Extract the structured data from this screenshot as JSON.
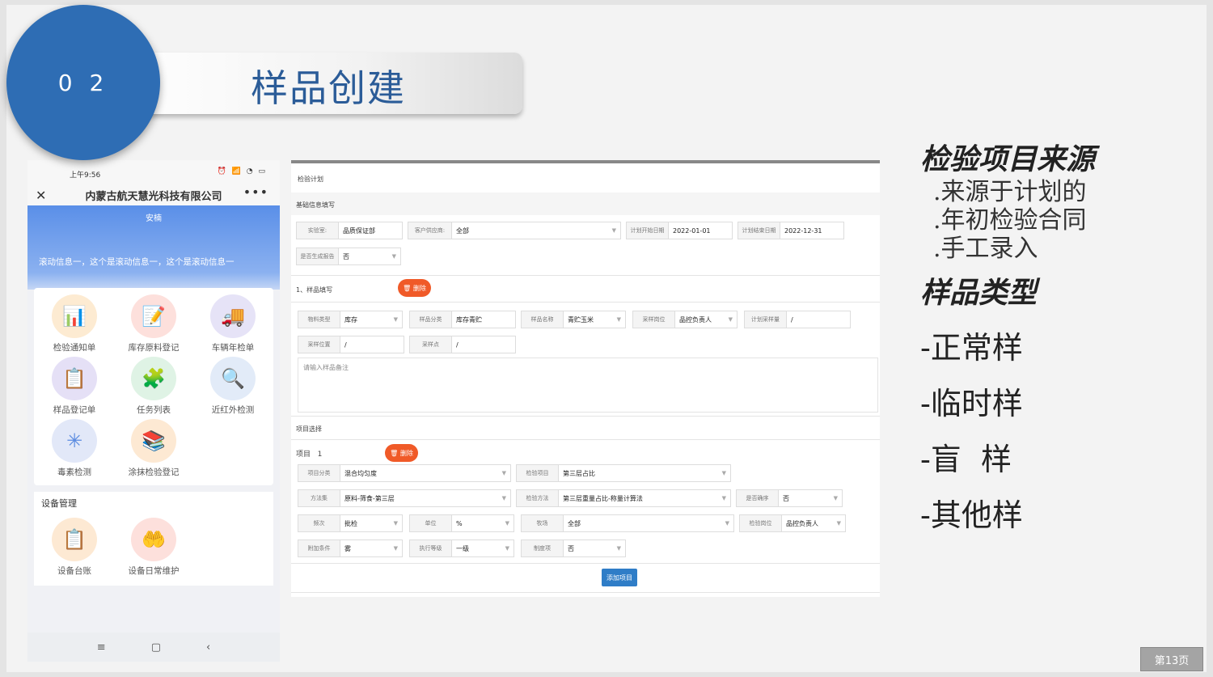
{
  "slide": {
    "number": "0 2",
    "title": "样品创建",
    "page": "第13页"
  },
  "phone": {
    "time": "上午9:56",
    "status_icons": "⏰ 📶 ◔ ▭",
    "company": "内蒙古航天慧光科技有限公司",
    "header": "安楠",
    "scroll_text": "滚动信息一，这个是滚动信息一，这个是滚动信息一",
    "apps": [
      {
        "label": "检验通知单",
        "icon": "📊",
        "color": "#fdebd2"
      },
      {
        "label": "库存原料登记",
        "icon": "📝",
        "color": "#fde0dc"
      },
      {
        "label": "车辆年检单",
        "icon": "🚚",
        "color": "#e6e3f7"
      },
      {
        "label": "样品登记单",
        "icon": "📋",
        "color": "#e5e0f6"
      },
      {
        "label": "任务列表",
        "icon": "🧩",
        "color": "#dff3e5"
      },
      {
        "label": "近红外检测",
        "icon": "🔍",
        "color": "#e2ebf8"
      },
      {
        "label": "毒素检测",
        "icon": "✳",
        "color": "#e2e8f8"
      },
      {
        "label": "涂抹检验登记",
        "icon": "📚",
        "color": "#fde9d3"
      }
    ],
    "device_section": "设备管理",
    "device_apps": [
      {
        "label": "设备台账",
        "icon": "📋",
        "color": "#fde9d3"
      },
      {
        "label": "设备日常维护",
        "icon": "🤲",
        "color": "#fde0dc"
      }
    ],
    "nav": [
      "≡",
      "▢",
      "‹"
    ]
  },
  "form": {
    "breadcrumb": "检验计划",
    "basic_section": "基础信息填写",
    "basic": {
      "lab_k": "实验室:",
      "lab_v": "品质保证部",
      "cust_k": "客户供应商:",
      "cust_v": "全部",
      "start_k": "计划开始日期",
      "start_v": "2022-01-01",
      "end_k": "计划结束日期",
      "end_v": "2022-12-31",
      "report_k": "是否生成报告",
      "report_v": "否"
    },
    "sample_section": "1、样品填写",
    "delete_label": "🗑 删除",
    "sample": {
      "type_k": "物料类型",
      "type_v": "库存",
      "cat_k": "样品分类",
      "cat_v": "库存青贮",
      "name_k": "样品名称",
      "name_v": "青贮玉米",
      "post_k": "采样岗位",
      "post_v": "品控负责人",
      "qty_k": "计划采样量",
      "qty_v": "/",
      "loc_k": "采样位置",
      "loc_v": "/",
      "point_k": "采样点",
      "point_v": "/"
    },
    "remark_placeholder": "请输入样品备注",
    "project_section": "项目选择",
    "project_label": "项目",
    "project_no": "1",
    "project": {
      "pcat_k": "项目分类",
      "pcat_v": "混合均匀度",
      "item_k": "检验项目",
      "item_v": "第三层占比",
      "method_k": "方法集",
      "method_v": "原料-筛食-第三层",
      "calc_k": "检验方法",
      "calc_v": "第三层重量占比-称量计算法",
      "seq_k": "是否确序",
      "seq_v": "否",
      "freq_k": "频次",
      "freq_v": "批检",
      "unit_k": "单位",
      "unit_v": "%",
      "site_k": "牧场",
      "site_v": "全部",
      "role_k": "检验岗位",
      "role_v": "品控负责人",
      "cond_k": "附加条件",
      "cond_v": "雾",
      "level_k": "执行等级",
      "level_v": "一级",
      "req_k": "制度项",
      "req_v": "否"
    },
    "add_button": "添加项目"
  },
  "right": {
    "h1": "检验项目来源",
    "sources": [
      ".来源于计划的",
      ".年初检验合同",
      ".手工录入"
    ],
    "h2": "样品类型",
    "types": [
      "-正常样",
      "-临时样",
      "-盲  样",
      "-其他样"
    ]
  }
}
